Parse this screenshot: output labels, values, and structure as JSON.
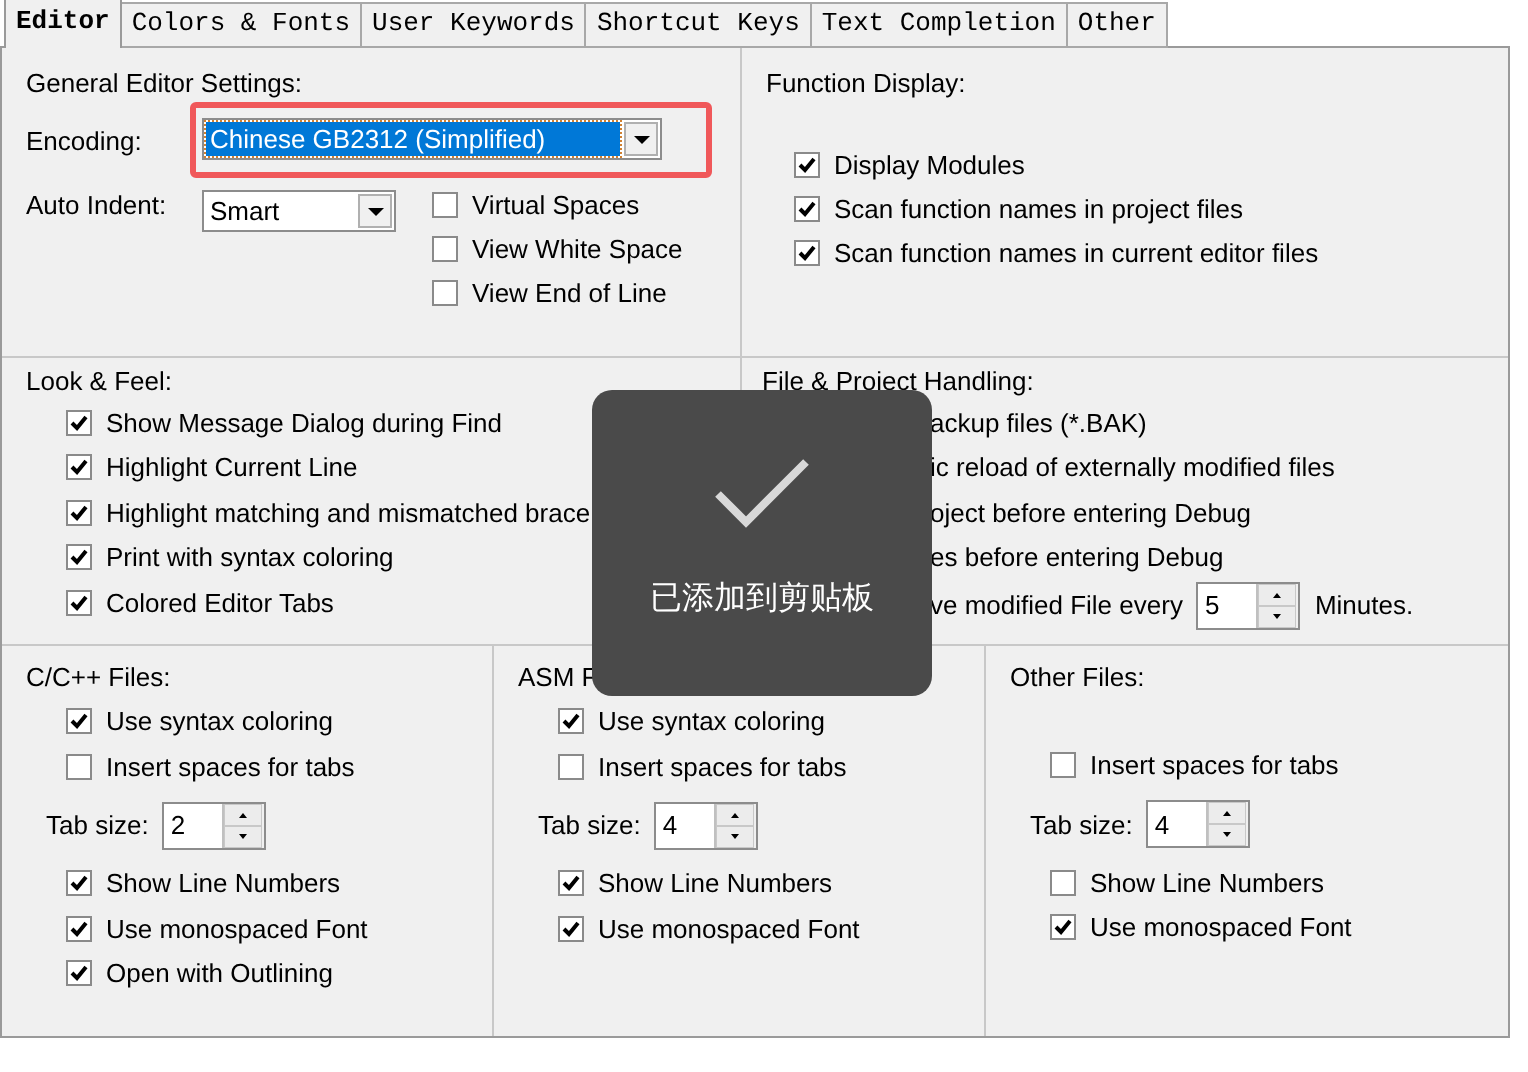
{
  "tabs": [
    {
      "label": "Editor",
      "selected": true
    },
    {
      "label": "Colors & Fonts",
      "selected": false
    },
    {
      "label": "User Keywords",
      "selected": false
    },
    {
      "label": "Shortcut Keys",
      "selected": false
    },
    {
      "label": "Text Completion",
      "selected": false
    },
    {
      "label": "Other",
      "selected": false
    }
  ],
  "general": {
    "title": "General Editor Settings:",
    "encoding": {
      "label": "Encoding:",
      "value": "Chinese GB2312 (Simplified)",
      "highlighted": true
    },
    "auto_indent": {
      "label": "Auto Indent:",
      "value": "Smart"
    },
    "options": [
      {
        "label": "Virtual Spaces",
        "checked": false
      },
      {
        "label": "View White Space",
        "checked": false
      },
      {
        "label": "View End of Line",
        "checked": false
      }
    ]
  },
  "function_display": {
    "title": "Function Display:",
    "options": [
      {
        "label": "Display Modules",
        "checked": true
      },
      {
        "label": "Scan function names in project files",
        "checked": true
      },
      {
        "label": "Scan function names in current editor files",
        "checked": true
      }
    ]
  },
  "look_feel": {
    "title": "Look & Feel:",
    "options": [
      {
        "label": "Show Message Dialog during Find",
        "checked": true
      },
      {
        "label": "Highlight Current Line",
        "checked": true
      },
      {
        "label": "Highlight matching and mismatched brace",
        "checked": true
      },
      {
        "label": "Print with syntax coloring",
        "checked": true
      },
      {
        "label": "Colored Editor Tabs",
        "checked": true
      }
    ]
  },
  "file_handling": {
    "title": "File & Project Handling:",
    "options": [
      {
        "kind": "partial",
        "label": "ackup files (*.BAK)"
      },
      {
        "kind": "partial",
        "label": "ic reload of externally modified files"
      },
      {
        "kind": "partial",
        "label": "oject before entering Debug"
      },
      {
        "kind": "partial",
        "label": "es before entering Debug"
      },
      {
        "kind": "autosave",
        "label": "ve modified File every",
        "value": "5",
        "unit": "Minutes."
      }
    ]
  },
  "file_groups": [
    {
      "title": "C/C++ Files:",
      "options": [
        {
          "kind": "check",
          "label": "Use syntax coloring",
          "checked": true
        },
        {
          "kind": "check",
          "label": "Insert spaces for tabs",
          "checked": false
        },
        {
          "kind": "tabsize",
          "label": "Tab size:",
          "value": "2"
        },
        {
          "kind": "check",
          "label": "Show Line Numbers",
          "checked": true
        },
        {
          "kind": "check",
          "label": "Use monospaced Font",
          "checked": true
        },
        {
          "kind": "check",
          "label": "Open with Outlining",
          "checked": true
        }
      ]
    },
    {
      "title": "ASM F",
      "options": [
        {
          "kind": "check",
          "label": "Use syntax coloring",
          "checked": true
        },
        {
          "kind": "check",
          "label": "Insert spaces for tabs",
          "checked": false
        },
        {
          "kind": "tabsize",
          "label": "Tab size:",
          "value": "4"
        },
        {
          "kind": "check",
          "label": "Show Line Numbers",
          "checked": true
        },
        {
          "kind": "check",
          "label": "Use monospaced Font",
          "checked": true
        }
      ]
    },
    {
      "title": "Other Files:",
      "options": [
        {
          "kind": "check",
          "label": "Insert spaces for tabs",
          "checked": false
        },
        {
          "kind": "tabsize",
          "label": "Tab size:",
          "value": "4"
        },
        {
          "kind": "check",
          "label": "Show Line Numbers",
          "checked": false
        },
        {
          "kind": "check",
          "label": "Use monospaced Font",
          "checked": true
        }
      ]
    }
  ],
  "toast": {
    "message": "已添加到剪贴板"
  }
}
